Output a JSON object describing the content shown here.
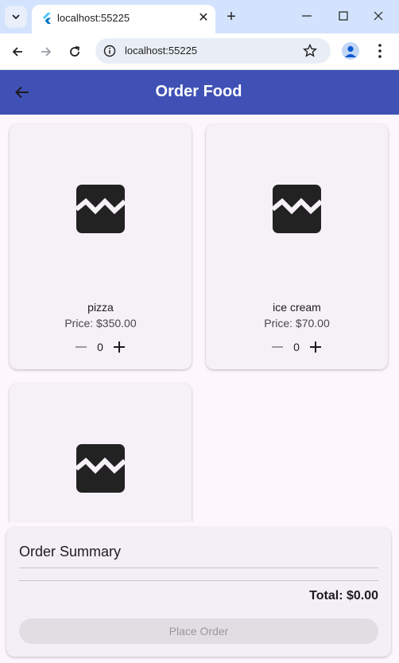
{
  "browser": {
    "tab_title": "localhost:55225",
    "new_tab_symbol": "+",
    "close_symbol": "✕",
    "url": "localhost:55225"
  },
  "app": {
    "title": "Order Food"
  },
  "foods": [
    {
      "name": "pizza",
      "price": "Price: $350.00",
      "quantity": "0"
    },
    {
      "name": "ice cream",
      "price": "Price: $70.00",
      "quantity": "0"
    },
    {
      "name": "",
      "price": "",
      "quantity": ""
    }
  ],
  "summary": {
    "title": "Order Summary",
    "total": "Total: $0.00",
    "place_order_label": "Place Order"
  },
  "colors": {
    "app_bar": "#3f51b5",
    "tab_strip": "#d3e3fd",
    "card_background": "#f5f1f7",
    "disabled_button": "#e2dde3"
  }
}
